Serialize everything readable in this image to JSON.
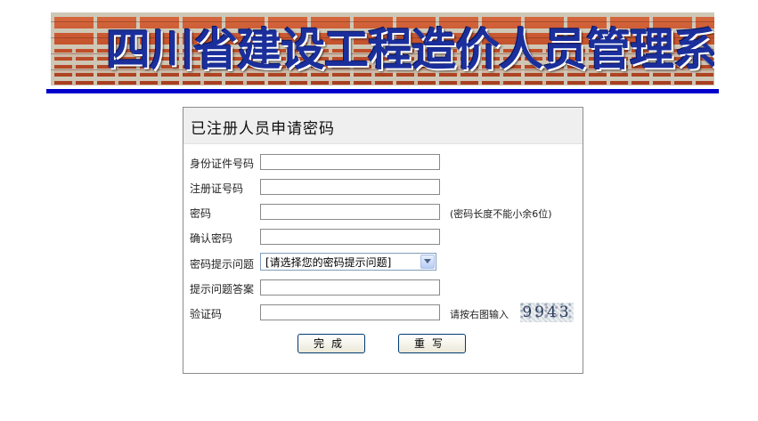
{
  "banner": {
    "title": "四川省建设工程造价人员管理系统"
  },
  "panel": {
    "title": "已注册人员申请密码"
  },
  "form": {
    "id_number": {
      "label": "身份证件号码",
      "value": ""
    },
    "reg_number": {
      "label": "注册证号码",
      "value": ""
    },
    "password": {
      "label": "密码",
      "value": "",
      "hint": "(密码长度不能小余6位)"
    },
    "confirm_password": {
      "label": "确认密码",
      "value": ""
    },
    "question": {
      "label": "密码提示问题",
      "selected": "[请选择您的密码提示问题]"
    },
    "answer": {
      "label": "提示问题答案",
      "value": ""
    },
    "captcha": {
      "label": "验证码",
      "value": "",
      "hint": "请按右图输入",
      "code": "9943"
    }
  },
  "buttons": {
    "submit": "完成",
    "reset": "重写"
  },
  "colors": {
    "banner_rule": "#0000cc",
    "banner_title": "#1b2f9c"
  }
}
